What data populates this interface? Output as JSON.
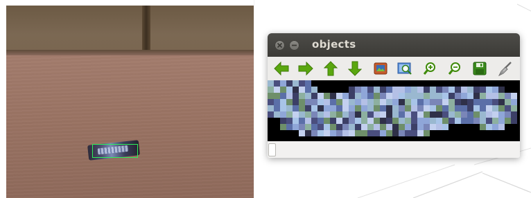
{
  "window": {
    "title": "objects"
  },
  "titlebar_buttons": {
    "close_icon": "close-icon",
    "minimize_icon": "minimize-icon"
  },
  "toolbar": {
    "items": [
      {
        "icon": "arrow-left-icon",
        "color": "#4e9a06"
      },
      {
        "icon": "arrow-right-icon",
        "color": "#4e9a06"
      },
      {
        "icon": "arrow-up-icon",
        "color": "#4e9a06"
      },
      {
        "icon": "arrow-down-icon",
        "color": "#4e9a06"
      },
      {
        "icon": "image-icon",
        "color": "#c0572a"
      },
      {
        "icon": "zoom-fit-icon",
        "color": "#3465a4"
      },
      {
        "icon": "zoom-in-icon",
        "color": "#4e9a06"
      },
      {
        "icon": "zoom-out-icon",
        "color": "#4e9a06"
      },
      {
        "icon": "save-icon",
        "color": "#2e7d1e"
      },
      {
        "icon": "clear-brush-icon",
        "color": "#8a8a8a"
      }
    ]
  },
  "camera": {
    "detection_box_color": "#2ef05a"
  },
  "colors": {
    "titlebar": "#3c3b37",
    "window_bg": "#f2f1f0",
    "image_bg": "#000000"
  }
}
